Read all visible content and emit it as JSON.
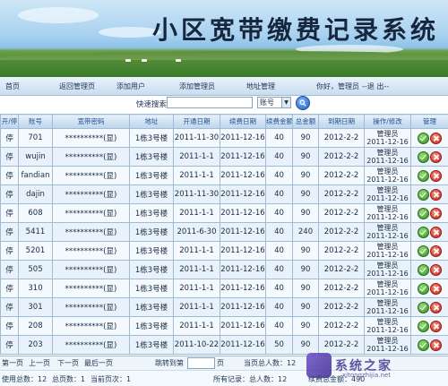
{
  "banner": {
    "title": "小区宽带缴费记录系统"
  },
  "nav": {
    "items": [
      "首页",
      "返回管理页",
      "添加用户",
      "添加管理员",
      "地址管理"
    ],
    "greeting": "你好，管理员",
    "logout": "--退  出--"
  },
  "search": {
    "label": "快速搜索",
    "value": "",
    "field_selected": "账号",
    "go_icon": "search-icon"
  },
  "table": {
    "headers": [
      "开/停",
      "账号",
      "宽带密码",
      "地址",
      "开通日期",
      "续费日期",
      "续费金额",
      "总金额",
      "到期日期",
      "操作/修改",
      "管理"
    ],
    "rows": [
      {
        "status": "停",
        "account": "701",
        "password": "**********(显)",
        "address": "1栋3号楼",
        "open": "2011-11-30",
        "renew": "2011-12-16",
        "fee": "40",
        "total": "90",
        "due": "2012-2-2",
        "op_user": "管理员",
        "op_date": "2011-12-16"
      },
      {
        "status": "停",
        "account": "wujin",
        "password": "**********(显)",
        "address": "1栋3号楼",
        "open": "2011-1-1",
        "renew": "2011-12-16",
        "fee": "40",
        "total": "90",
        "due": "2012-2-2",
        "op_user": "管理员",
        "op_date": "2011-12-16"
      },
      {
        "status": "停",
        "account": "fandian",
        "password": "**********(显)",
        "address": "1栋3号楼",
        "open": "2011-1-1",
        "renew": "2011-12-16",
        "fee": "40",
        "total": "90",
        "due": "2012-2-2",
        "op_user": "管理员",
        "op_date": "2011-12-16"
      },
      {
        "status": "停",
        "account": "dajin",
        "password": "**********(显)",
        "address": "1栋3号楼",
        "open": "2011-11-30",
        "renew": "2011-12-16",
        "fee": "40",
        "total": "90",
        "due": "2012-2-2",
        "op_user": "管理员",
        "op_date": "2011-12-16"
      },
      {
        "status": "停",
        "account": "608",
        "password": "**********(显)",
        "address": "1栋3号楼",
        "open": "2011-1-1",
        "renew": "2011-12-16",
        "fee": "40",
        "total": "90",
        "due": "2012-2-2",
        "op_user": "管理员",
        "op_date": "2011-12-16"
      },
      {
        "status": "停",
        "account": "5411",
        "password": "**********(显)",
        "address": "1栋3号楼",
        "open": "2011-6-30",
        "renew": "2011-12-16",
        "fee": "40",
        "total": "240",
        "due": "2012-2-2",
        "op_user": "管理员",
        "op_date": "2011-12-16"
      },
      {
        "status": "停",
        "account": "5201",
        "password": "**********(显)",
        "address": "1栋3号楼",
        "open": "2011-1-1",
        "renew": "2011-12-16",
        "fee": "40",
        "total": "90",
        "due": "2012-2-2",
        "op_user": "管理员",
        "op_date": "2011-12-16"
      },
      {
        "status": "停",
        "account": "505",
        "password": "**********(显)",
        "address": "1栋3号楼",
        "open": "2011-1-1",
        "renew": "2011-12-16",
        "fee": "40",
        "total": "90",
        "due": "2012-2-2",
        "op_user": "管理员",
        "op_date": "2011-12-16"
      },
      {
        "status": "停",
        "account": "310",
        "password": "**********(显)",
        "address": "1栋3号楼",
        "open": "2011-1-1",
        "renew": "2011-12-16",
        "fee": "40",
        "total": "90",
        "due": "2012-2-2",
        "op_user": "管理员",
        "op_date": "2011-12-16"
      },
      {
        "status": "停",
        "account": "301",
        "password": "**********(显)",
        "address": "1栋3号楼",
        "open": "2011-1-1",
        "renew": "2011-12-16",
        "fee": "40",
        "total": "90",
        "due": "2012-2-2",
        "op_user": "管理员",
        "op_date": "2011-12-16"
      },
      {
        "status": "停",
        "account": "208",
        "password": "**********(显)",
        "address": "1栋3号楼",
        "open": "2011-1-1",
        "renew": "2011-12-16",
        "fee": "40",
        "total": "90",
        "due": "2012-2-2",
        "op_user": "管理员",
        "op_date": "2011-12-16"
      },
      {
        "status": "停",
        "account": "203",
        "password": "**********(显)",
        "address": "1栋3号楼",
        "open": "2011-10-22",
        "renew": "2011-12-16",
        "fee": "50",
        "total": "90",
        "due": "2012-2-2",
        "op_user": "管理员",
        "op_date": "2011-12-16"
      }
    ]
  },
  "pager": {
    "first": "第一页",
    "prev": "上一页",
    "next": "下一页",
    "last": "最后一页",
    "jump_label": "跳转到第",
    "page_suffix": "页",
    "page_total": "当页总人数：12"
  },
  "footer": {
    "user_total": "使用总数：12",
    "page_count": "总页数：1",
    "current_page": "当前页次：1",
    "all_records": "所有记录：总人数：12",
    "renew_total": "续费总金额：490"
  },
  "watermark": {
    "text": "系统之家",
    "url": "xitongzhijia.net"
  },
  "colors": {
    "header_text": "#1f4f93",
    "grid_border": "#9fbcd6",
    "ok_button": "#2f8a1c",
    "delete_button": "#c8231a"
  }
}
